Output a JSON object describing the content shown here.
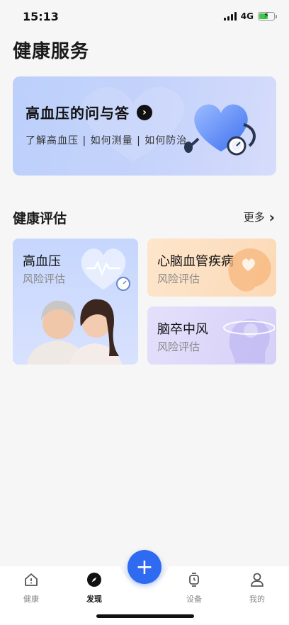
{
  "status_bar": {
    "time": "15:13",
    "network": "4G"
  },
  "page": {
    "title": "健康服务"
  },
  "banner": {
    "title": "高血压的问与答",
    "subtitle": "了解高血压 | 如何测量 | 如何防治",
    "icon": "heart-with-blood-pressure-gauge"
  },
  "assessment": {
    "section_title": "健康评估",
    "more_label": "更多",
    "cards": [
      {
        "title": "高血压",
        "subtitle": "风险评估",
        "icon": "heart-pulse-icon"
      },
      {
        "title": "心脑血管疾病",
        "subtitle": "风险评估",
        "icon": "brain-heart-icon"
      },
      {
        "title": "脑卒中风",
        "subtitle": "风险评估",
        "icon": "head-orbit-icon"
      }
    ]
  },
  "tabbar": {
    "items": [
      {
        "label": "健康",
        "icon": "home-icon",
        "active": false
      },
      {
        "label": "发现",
        "icon": "compass-icon",
        "active": true
      },
      {
        "label": "设备",
        "icon": "watch-icon",
        "active": false
      },
      {
        "label": "我的",
        "icon": "person-icon",
        "active": false
      }
    ],
    "fab_label": "+"
  },
  "colors": {
    "accent": "#2f6bf0",
    "banner_bg": "#c6d3fb",
    "card_hbp_bg": "#ccdafd",
    "card_cvd_bg": "#fce0c1",
    "card_stroke_bg": "#ddd8fa"
  }
}
